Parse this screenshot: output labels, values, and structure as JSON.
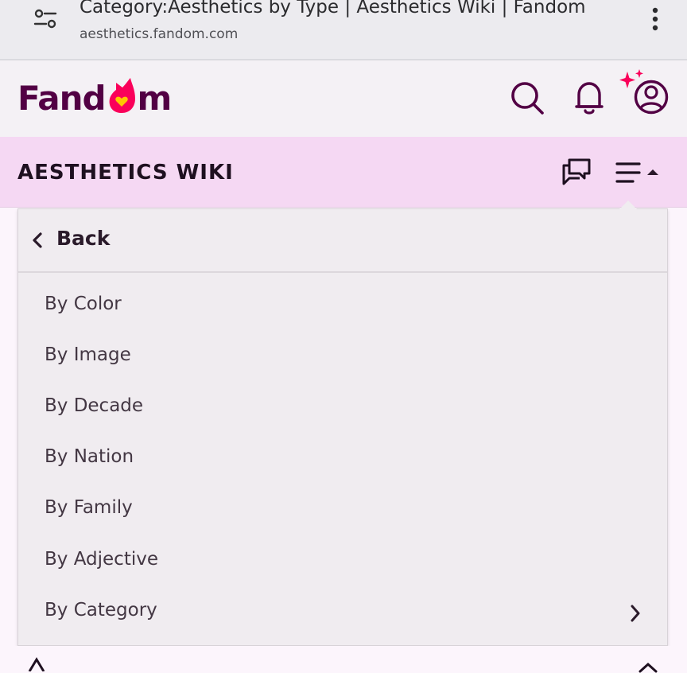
{
  "browser": {
    "page_title": "Category:Aesthetics by Type | Aesthetics Wiki | Fandom",
    "domain": "aesthetics.fandom.com"
  },
  "header": {
    "logo_text_left": "Fand",
    "logo_text_right": "m",
    "brand_color": "#520044",
    "accent_color": "#fa005a",
    "icons": [
      "search-icon",
      "notification-bell-icon",
      "user-account-icon"
    ]
  },
  "wiki_bar": {
    "name": "AESTHETICS WIKI",
    "background_color": "#f5d8f3",
    "icons": [
      "discussions-icon",
      "hamburger-menu-icon"
    ]
  },
  "menu": {
    "back_label": "Back",
    "items": [
      {
        "label": "By Color"
      },
      {
        "label": "By Image"
      },
      {
        "label": "By Decade"
      },
      {
        "label": "By Nation"
      },
      {
        "label": "By Family"
      },
      {
        "label": "By Adjective"
      },
      {
        "label": "By Category",
        "has_submenu": true
      }
    ]
  }
}
